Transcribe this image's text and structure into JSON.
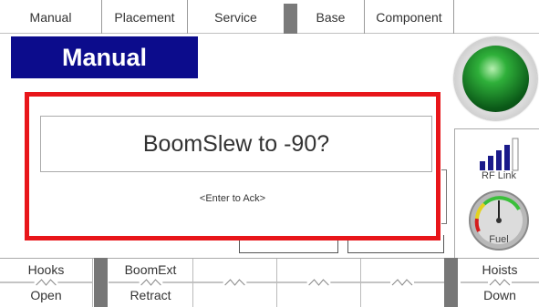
{
  "tabs": [
    {
      "label": "Manual"
    },
    {
      "label": "Placement"
    },
    {
      "label": "Service"
    },
    {
      "label": "Base"
    },
    {
      "label": "Component"
    }
  ],
  "mode_title": "Manual",
  "status_indicator": {
    "color": "#1e8a2e"
  },
  "rf_link": {
    "label": "RF Link",
    "bars_active": 4,
    "bars_total": 5
  },
  "fuel_gauge": {
    "label": "Fuel"
  },
  "dialog": {
    "message": "BoomSlew to -90?",
    "hint": "<Enter to Ack>",
    "border_color": "#e8161a"
  },
  "controls": [
    {
      "top": "Hooks",
      "bottom": "Open"
    },
    {
      "top": "BoomExt",
      "bottom": "Retract"
    },
    {
      "top": "",
      "bottom": ""
    },
    {
      "top": "",
      "bottom": ""
    },
    {
      "top": "",
      "bottom": ""
    },
    {
      "top": "Hoists",
      "bottom": "Down"
    }
  ],
  "colors": {
    "mode_bg": "#0c0c8c",
    "separator": "#777777"
  }
}
